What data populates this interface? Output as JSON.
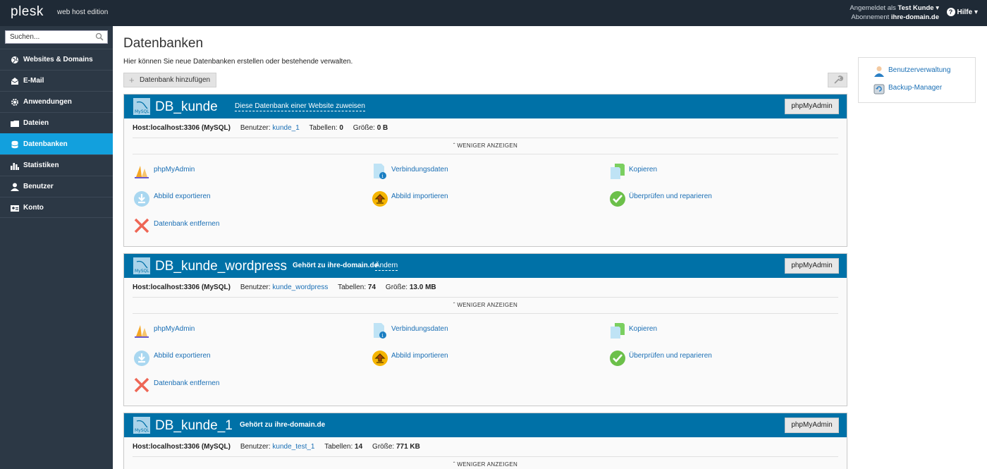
{
  "topbar": {
    "logo": "plesk",
    "edition": "web host edition",
    "logged_in_label": "Angemeldet als",
    "user_name": "Test Kunde",
    "subscription_label": "Abonnement",
    "subscription_value": "ihre-domain.de",
    "help_label": "Hilfe"
  },
  "sidebar": {
    "search_placeholder": "Suchen...",
    "items": [
      {
        "label": "Websites & Domains",
        "icon": "globe-icon"
      },
      {
        "label": "E-Mail",
        "icon": "mail-icon"
      },
      {
        "label": "Anwendungen",
        "icon": "gear-icon"
      },
      {
        "label": "Dateien",
        "icon": "folder-icon"
      },
      {
        "label": "Datenbanken",
        "icon": "database-icon",
        "active": true
      },
      {
        "label": "Statistiken",
        "icon": "chart-icon"
      },
      {
        "label": "Benutzer",
        "icon": "user-icon"
      },
      {
        "label": "Konto",
        "icon": "account-icon"
      }
    ]
  },
  "page": {
    "title": "Datenbanken",
    "description": "Hier können Sie neue Datenbanken erstellen oder bestehende verwalten.",
    "add_button": "Datenbank hinzufügen"
  },
  "rightbox": {
    "links": [
      "Benutzerverwaltung",
      "Backup-Manager"
    ]
  },
  "labels": {
    "phpmyadmin_button": "phpMyAdmin",
    "host_label": "Host:",
    "user_label": "Benutzer:",
    "tables_label": "Tabellen:",
    "size_label": "Größe:",
    "less": "WENIGER ANZEIGEN",
    "assign": "Diese Datenbank einer Website zuweisen",
    "belongs": "Gehört zu",
    "change": "Ändern",
    "actions": {
      "phpmyadmin": "phpMyAdmin",
      "connection": "Verbindungsdaten",
      "copy": "Kopieren",
      "export": "Abbild exportieren",
      "import": "Abbild importieren",
      "check": "Überprüfen und reparieren",
      "remove": "Datenbank entfernen"
    }
  },
  "databases": [
    {
      "name": "DB_kunde",
      "host": "localhost:3306 (MySQL)",
      "user": "kunde_1",
      "tables": "0",
      "size": "0 B",
      "domain": ""
    },
    {
      "name": "DB_kunde_wordpress",
      "host": "localhost:3306 (MySQL)",
      "user": "kunde_wordpress",
      "tables": "74",
      "size": "13.0 MB",
      "domain": "ihre-domain.de"
    },
    {
      "name": "DB_kunde_1",
      "host": "localhost:3306 (MySQL)",
      "user": "kunde_test_1",
      "tables": "14",
      "size": "771 KB",
      "domain": "ihre-domain.de"
    }
  ]
}
